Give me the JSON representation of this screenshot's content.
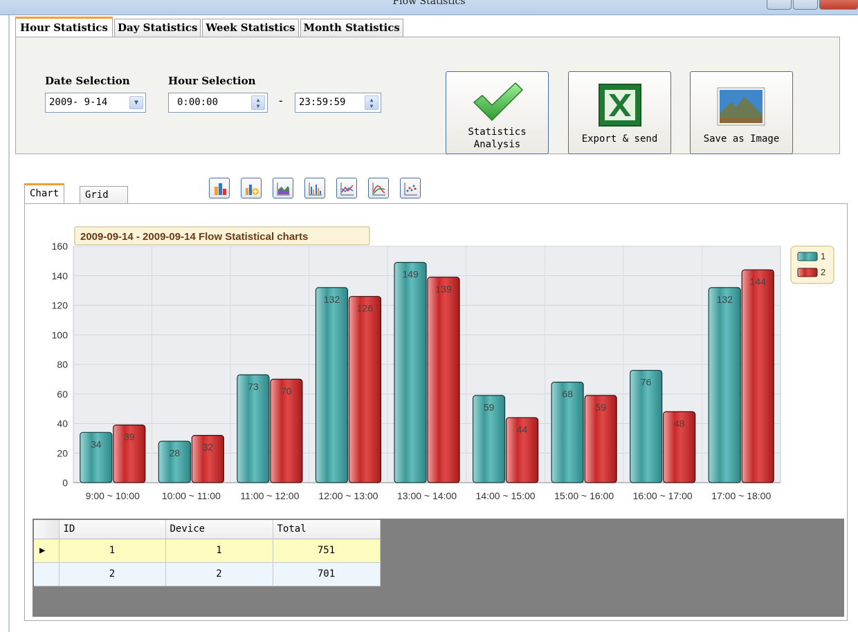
{
  "window": {
    "title": "Flow Statistics"
  },
  "tabs": [
    {
      "label": "Hour Statistics",
      "active": true
    },
    {
      "label": "Day Statistics",
      "active": false
    },
    {
      "label": "Week Statistics",
      "active": false
    },
    {
      "label": "Month Statistics",
      "active": false
    }
  ],
  "filters": {
    "date_label": "Date Selection",
    "date_value": "2009- 9-14",
    "hour_label": "Hour Selection",
    "hour_from": "0:00:00",
    "hour_separator": "-",
    "hour_to": "23:59:59"
  },
  "actions": {
    "analysis_line1": "Statistics",
    "analysis_line2": "Analysis",
    "export_label": "Export & send",
    "save_label": "Save as Image"
  },
  "view_tabs": {
    "chart": "Chart",
    "grid": "Grid"
  },
  "chart_tools": [
    "bar-3d-icon",
    "chart-wizard-icon",
    "area-chart-icon",
    "column-chart-icon",
    "line-chart-icon",
    "curve-chart-icon",
    "scatter-chart-icon"
  ],
  "chart_data": {
    "type": "bar",
    "title": "2009-09-14 - 2009-09-14 Flow Statistical charts",
    "categories": [
      "9:00 ~ 10:00",
      "10:00 ~ 11:00",
      "11:00 ~ 12:00",
      "12:00 ~ 13:00",
      "13:00 ~ 14:00",
      "14:00 ~ 15:00",
      "15:00 ~ 16:00",
      "16:00 ~ 17:00",
      "17:00 ~ 18:00"
    ],
    "series": [
      {
        "name": "1",
        "values": [
          34,
          28,
          73,
          132,
          149,
          59,
          68,
          76,
          132
        ],
        "color": "#4aa8a8"
      },
      {
        "name": "2",
        "values": [
          39,
          32,
          70,
          126,
          139,
          44,
          59,
          48,
          144
        ],
        "color": "#d43a3a"
      }
    ],
    "ylim": [
      0,
      160
    ],
    "yticks": [
      0,
      20,
      40,
      60,
      80,
      100,
      120,
      140,
      160
    ],
    "grid": true,
    "legend": "right",
    "xlabel": "",
    "ylabel": ""
  },
  "table": {
    "columns": [
      "ID",
      "Device",
      "Total"
    ],
    "rows": [
      {
        "id": "1",
        "device": "1",
        "total": "751",
        "selected": true
      },
      {
        "id": "2",
        "device": "2",
        "total": "701",
        "selected": false
      }
    ]
  }
}
